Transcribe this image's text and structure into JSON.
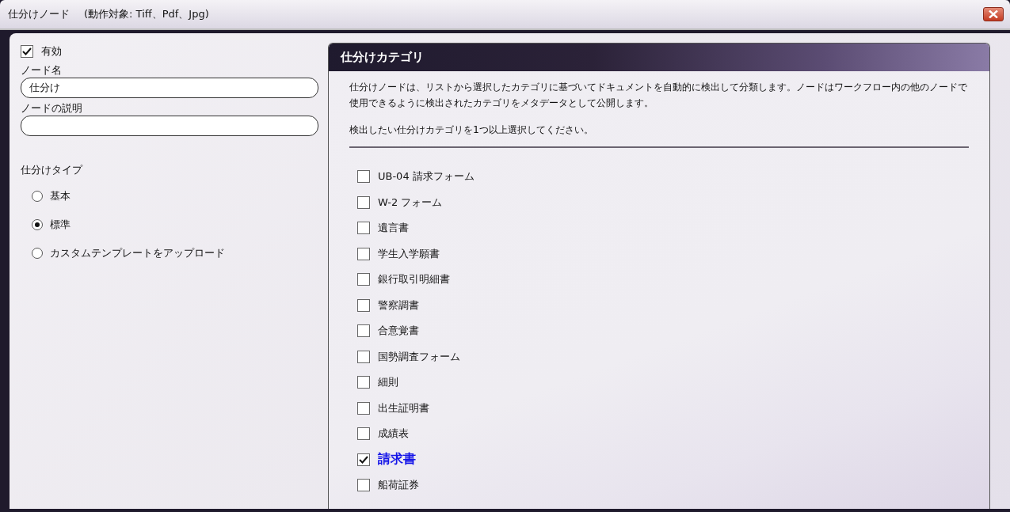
{
  "window": {
    "title": "仕分けノード",
    "subtitle": "(動作対象: Tiff、Pdf、Jpg)"
  },
  "enabled": {
    "label": "有効",
    "checked": true
  },
  "fields": [
    {
      "label": "ノード名",
      "value": "仕分け"
    },
    {
      "label": "ノードの説明"
    }
  ],
  "sort_type": {
    "label": "仕分けタイプ",
    "options": [
      {
        "label": "基本",
        "selected": false
      },
      {
        "label": "標準",
        "selected": true
      },
      {
        "label": "カスタムテンプレートをアップロード",
        "selected": false
      }
    ]
  },
  "panel": {
    "title": "仕分けカテゴリ",
    "description": "仕分けノードは、リストから選択したカテゴリに基づいてドキュメントを自動的に検出して分類します。ノードはワークフロー内の他のノードで使用できるように検出されたカテゴリをメタデータとして公開します。",
    "instruction": "検出したい仕分けカテゴリを1つ以上選択してください。",
    "categories": [
      {
        "label": "UB-04 請求フォーム",
        "checked": false
      },
      {
        "label": "W-2 フォーム",
        "checked": false
      },
      {
        "label": "遺言書",
        "checked": false
      },
      {
        "label": "学生入学願書",
        "checked": false
      },
      {
        "label": "銀行取引明細書",
        "checked": false
      },
      {
        "label": "警察調書",
        "checked": false
      },
      {
        "label": "合意覚書",
        "checked": false
      },
      {
        "label": "国勢調査フォーム",
        "checked": false
      },
      {
        "label": "細則",
        "checked": false
      },
      {
        "label": "出生証明書",
        "checked": false
      },
      {
        "label": "成績表",
        "checked": false
      },
      {
        "label": "請求書",
        "checked": true
      },
      {
        "label": "船荷証券",
        "checked": false
      }
    ]
  }
}
